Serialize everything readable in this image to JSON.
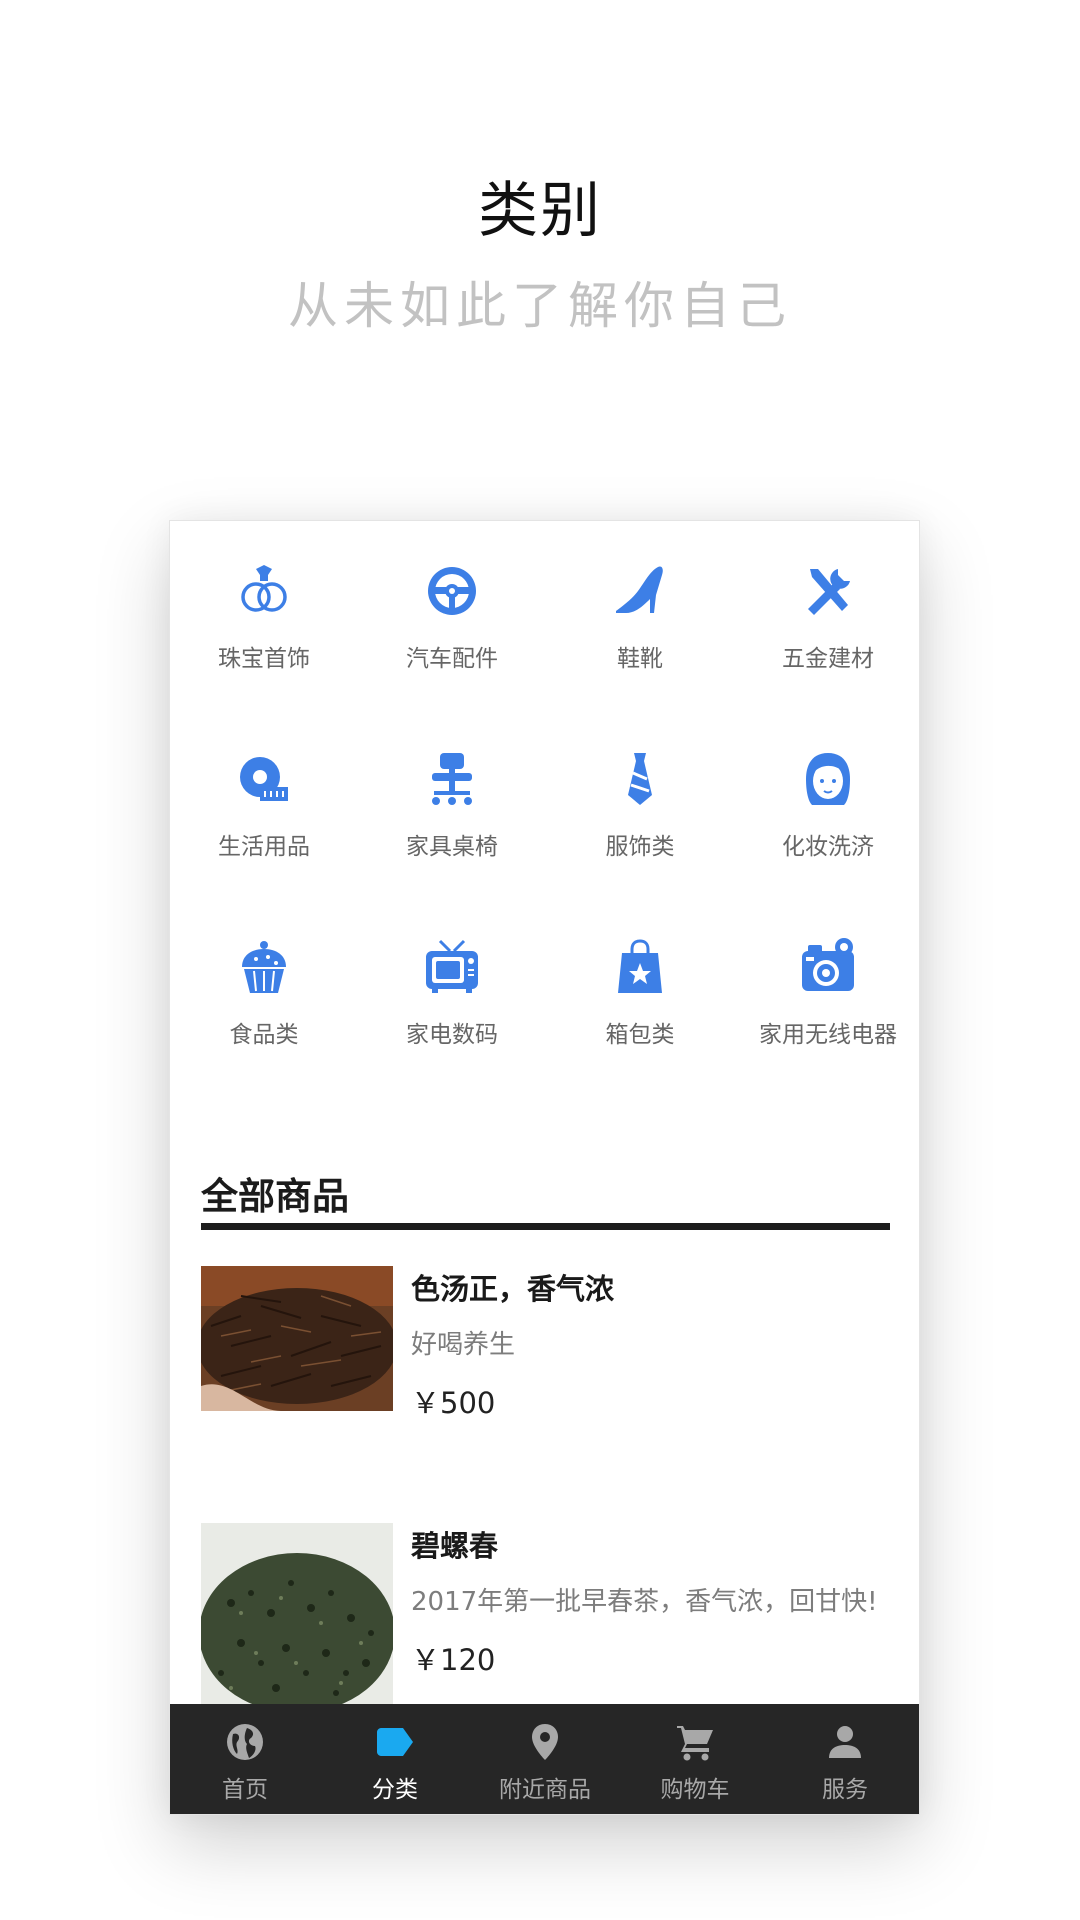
{
  "header": {
    "title": "类别",
    "subtitle": "从未如此了解你自己"
  },
  "accent_color": "#3d7fe6",
  "categories": [
    {
      "label": "珠宝首饰",
      "icon": "ring-icon"
    },
    {
      "label": "汽车配件",
      "icon": "steering-wheel-icon"
    },
    {
      "label": "鞋靴",
      "icon": "high-heel-icon"
    },
    {
      "label": "五金建材",
      "icon": "tools-icon"
    },
    {
      "label": "生活用品",
      "icon": "tape-measure-icon"
    },
    {
      "label": "家具桌椅",
      "icon": "office-chair-icon"
    },
    {
      "label": "服饰类",
      "icon": "necktie-icon"
    },
    {
      "label": "化妆洗济",
      "icon": "woman-face-icon"
    },
    {
      "label": "食品类",
      "icon": "cupcake-icon"
    },
    {
      "label": "家电数码",
      "icon": "tv-icon"
    },
    {
      "label": "箱包类",
      "icon": "shopping-bag-icon"
    },
    {
      "label": "家用无线电器",
      "icon": "camera-icon"
    }
  ],
  "section": {
    "title": "全部商品"
  },
  "products": [
    {
      "name": "色汤正，香气浓",
      "desc": "好喝养生",
      "price": "￥500",
      "image": "dark-tea-leaves"
    },
    {
      "name": "碧螺春",
      "desc": "2017年第一批早春茶，香气浓，回甘快!",
      "price": "￥120",
      "image": "green-tea-pellets"
    }
  ],
  "tabbar": {
    "active_color": "#1aa9f0",
    "items": [
      {
        "label": "首页",
        "icon": "globe-icon",
        "active": false
      },
      {
        "label": "分类",
        "icon": "tag-icon",
        "active": true
      },
      {
        "label": "附近商品",
        "icon": "location-pin-icon",
        "active": false
      },
      {
        "label": "购物车",
        "icon": "cart-icon",
        "active": false
      },
      {
        "label": "服务",
        "icon": "person-icon",
        "active": false
      }
    ]
  }
}
